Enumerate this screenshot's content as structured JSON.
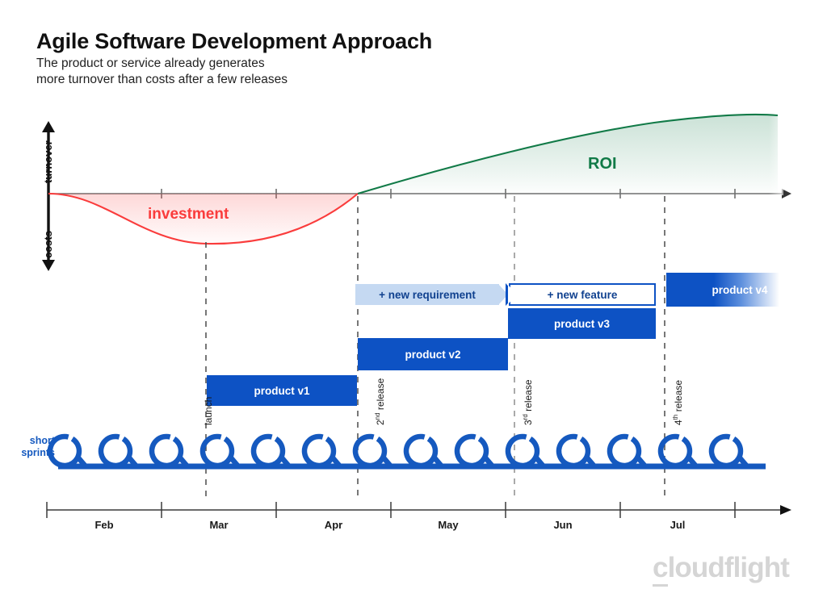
{
  "header": {
    "title": "Agile Software Development Approach",
    "subtitle": "The product or service already generates\nmore turnover than costs after a few releases"
  },
  "axes": {
    "y_top_label": "turnover",
    "y_bottom_label": "costs",
    "x_ticks": [
      "Feb",
      "Mar",
      "Apr",
      "May",
      "Jun",
      "Jul"
    ]
  },
  "curves": {
    "investment_label": "investment",
    "investment_color": "#fa3c3c",
    "roi_label": "ROI",
    "roi_color": "#117a47"
  },
  "markers": [
    {
      "name": "launch",
      "label": "launch",
      "sup": ""
    },
    {
      "name": "release-2",
      "label": " release",
      "sup": "nd",
      "ordinal": "2"
    },
    {
      "name": "release-3",
      "label": " release",
      "sup": "rd",
      "ordinal": "3"
    },
    {
      "name": "release-4",
      "label": " release",
      "sup": "th",
      "ordinal": "4"
    }
  ],
  "bars": {
    "v1": "product v1",
    "v2": "product v2",
    "v3": "product v3",
    "v4": "product v4",
    "new_requirement": "+ new requirement",
    "new_feature": "+ new feature"
  },
  "sprints": {
    "label": "short\nsprints",
    "color": "#1559bf",
    "count": 14
  },
  "logo": {
    "lead": "c",
    "rest": "loudflight",
    "color": "#d5d5d5"
  },
  "chart_data": {
    "type": "line",
    "title": "Agile Software Development Approach",
    "subtitle": "The product or service already generates more turnover than costs after a few releases",
    "xlabel": "",
    "ylabel": "turnover / costs",
    "grid": false,
    "legend": "inline-annotations",
    "x_tick_labels": [
      "Feb",
      "Mar",
      "Apr",
      "May",
      "Jun",
      "Jul"
    ],
    "y_axis_sections": [
      "turnover",
      "costs"
    ],
    "zero_crossing_month": "mid-Apr",
    "series": [
      {
        "name": "investment",
        "color": "#fa3c3c",
        "region": "costs",
        "points": [
          {
            "x": "Feb (start)",
            "y": 0
          },
          {
            "x": "late Feb",
            "y": -28
          },
          {
            "x": "Mar",
            "y": -44
          },
          {
            "x": "late Mar",
            "y": -40
          },
          {
            "x": "Apr",
            "y": -22
          },
          {
            "x": "mid-Apr",
            "y": 0
          }
        ],
        "minimum": {
          "x": "Mar",
          "y": -44
        }
      },
      {
        "name": "ROI",
        "color": "#117a47",
        "region": "turnover",
        "points": [
          {
            "x": "mid-Apr",
            "y": 0
          },
          {
            "x": "May",
            "y": 22
          },
          {
            "x": "Jun",
            "y": 50
          },
          {
            "x": "Jul",
            "y": 75
          },
          {
            "x": "late Jul",
            "y": 88
          }
        ]
      }
    ],
    "timeline_bars": [
      {
        "label": "product v1",
        "start": "late Feb",
        "end": "Apr",
        "lane": 1,
        "style": "solid"
      },
      {
        "label": "product v2",
        "start": "mid-Apr",
        "end": "late May",
        "lane": 2,
        "style": "solid"
      },
      {
        "label": "product v3",
        "start": "Jun",
        "end": "Jul",
        "lane": 3,
        "style": "solid"
      },
      {
        "label": "product v4",
        "start": "Jul",
        "end": "beyond",
        "lane": 4,
        "style": "fading"
      },
      {
        "label": "+ new requirement",
        "start": "mid-Apr",
        "end": "Jun",
        "lane": 4,
        "style": "light-arrow"
      },
      {
        "label": "+ new feature",
        "start": "Jun",
        "end": "Jul",
        "lane": 4,
        "style": "outline-chevron"
      }
    ],
    "milestones": [
      "launch",
      "2nd release",
      "3rd release",
      "4th release"
    ],
    "sprint_count": 14
  }
}
